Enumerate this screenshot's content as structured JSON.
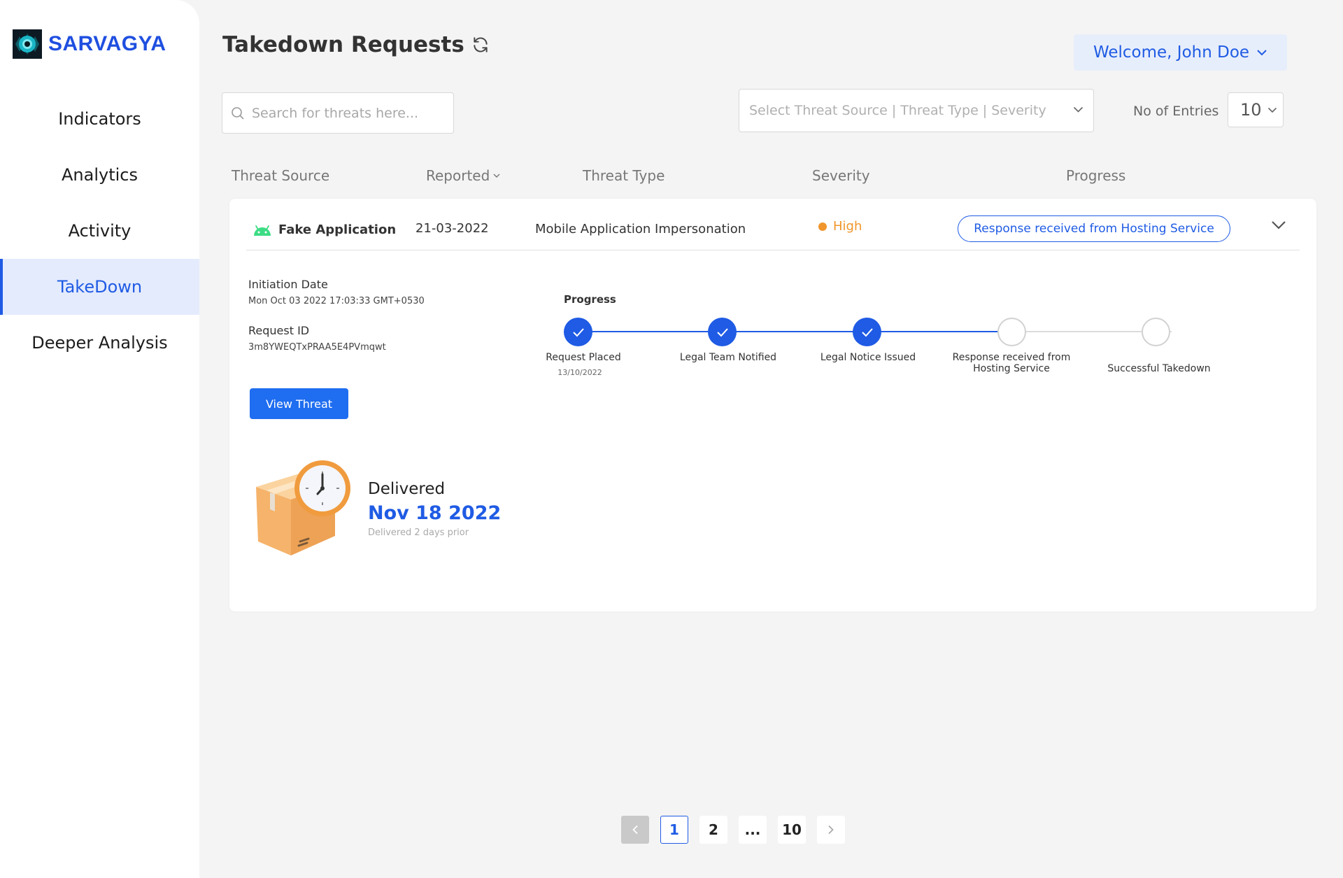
{
  "app": {
    "name": "SARVAGYA"
  },
  "sidebar": {
    "items": [
      {
        "label": "Indicators",
        "active": false
      },
      {
        "label": "Analytics",
        "active": false
      },
      {
        "label": "Activity",
        "active": false
      },
      {
        "label": "TakeDown",
        "active": true
      },
      {
        "label": "Deeper Analysis",
        "active": false
      }
    ]
  },
  "header": {
    "title": "Takedown Requests",
    "welcome": "Welcome, John Doe"
  },
  "filters": {
    "search_placeholder": "Search for threats here...",
    "select_placeholder": "Select Threat Source |  Threat Type | Severity",
    "entries_label": "No of Entries",
    "entries_value": "10"
  },
  "table": {
    "columns": [
      "Threat Source",
      "Reported",
      "Threat Type",
      "Severity",
      "Progress"
    ],
    "row": {
      "source": "Fake Application",
      "reported": "21-03-2022",
      "threat_type": "Mobile Application Impersonation",
      "severity": "High",
      "status": "Response received from Hosting Service"
    }
  },
  "details": {
    "initiation_label": "Initiation Date",
    "initiation_value": "Mon Oct 03 2022 17:03:33 GMT+0530",
    "request_label": "Request ID",
    "request_value": "3m8YWEQTxPRAA5E4PVmqwt",
    "view_button": "View Threat",
    "progress_title": "Progress",
    "steps": [
      {
        "label": "Request Placed",
        "sub": "13/10/2022",
        "done": true
      },
      {
        "label": "Legal Team Notified",
        "sub": "",
        "done": true
      },
      {
        "label": "Legal Notice Issued",
        "sub": "",
        "done": true
      },
      {
        "label": "Response received from Hosting Service",
        "sub": "",
        "done": false
      },
      {
        "label": "Successful Takedown",
        "sub": "",
        "done": false
      }
    ],
    "delivered_label": "Delivered",
    "delivered_date": "Nov 18 2022",
    "delivered_sub": "Delivered 2 days prior"
  },
  "pagination": {
    "pages": [
      "1",
      "2",
      "...",
      "10"
    ],
    "current": "1"
  },
  "colors": {
    "accent": "#1f5be4",
    "severity_high": "#f0962c",
    "android": "#3ddc84"
  },
  "icons": [
    "refresh-icon",
    "search-icon",
    "chevron-down-icon",
    "android-icon",
    "check-icon",
    "chevron-left-icon",
    "chevron-right-icon"
  ]
}
